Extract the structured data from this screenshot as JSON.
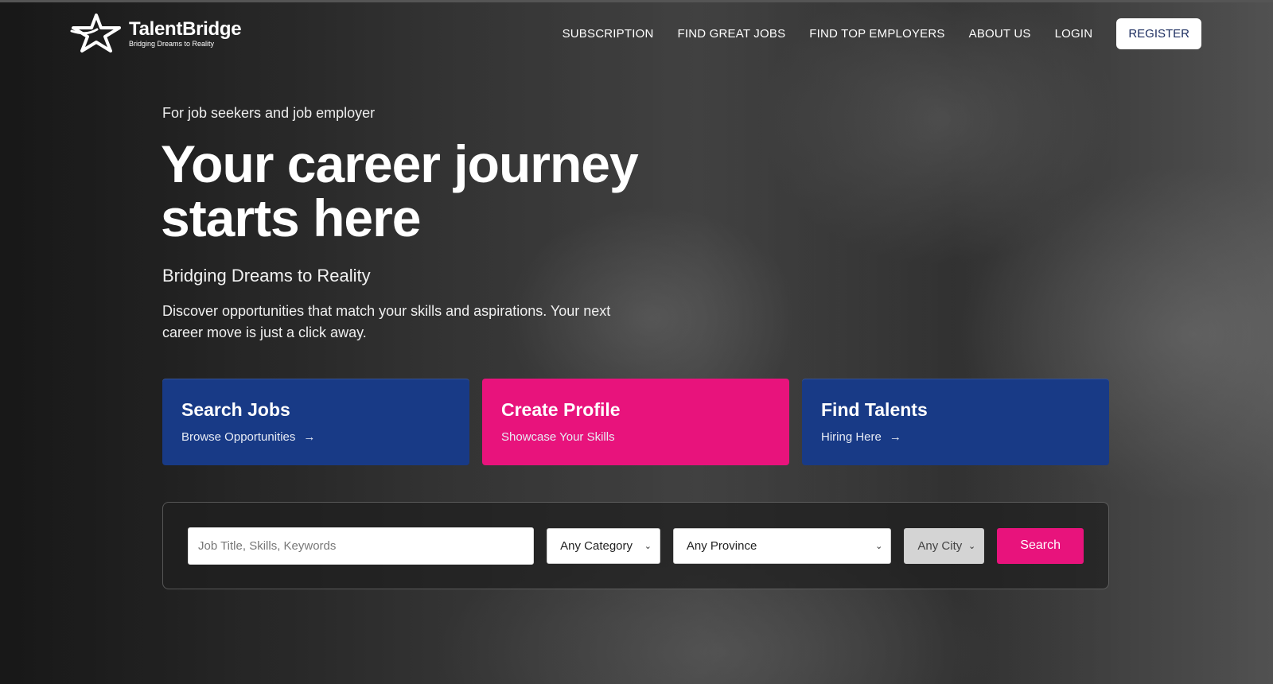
{
  "brand": {
    "name": "TalentBridge",
    "tagline": "Bridging Dreams to Reality"
  },
  "nav": {
    "items": [
      "SUBSCRIPTION",
      "FIND GREAT JOBS",
      "FIND TOP EMPLOYERS",
      "ABOUT US",
      "LOGIN"
    ],
    "register_label": "REGISTER"
  },
  "hero": {
    "eyebrow": "For job seekers and job employer",
    "headline": "Your career journey starts here",
    "subhead": "Bridging Dreams to Reality",
    "description": "Discover opportunities that match your skills and aspirations. Your next career move is just a click away."
  },
  "cards": [
    {
      "title": "Search Jobs",
      "subtitle": "Browse Opportunities",
      "arrow": "→"
    },
    {
      "title": "Create Profile",
      "subtitle": "Showcase Your Skills"
    },
    {
      "title": "Find Talents",
      "subtitle": "Hiring Here",
      "arrow": "→"
    }
  ],
  "search": {
    "keyword_placeholder": "Job Title, Skills, Keywords",
    "category_value": "Any Category",
    "province_value": "Any Province",
    "city_value": "Any City",
    "button_label": "Search"
  },
  "colors": {
    "navy": "#183a86",
    "pink": "#e8137c"
  }
}
